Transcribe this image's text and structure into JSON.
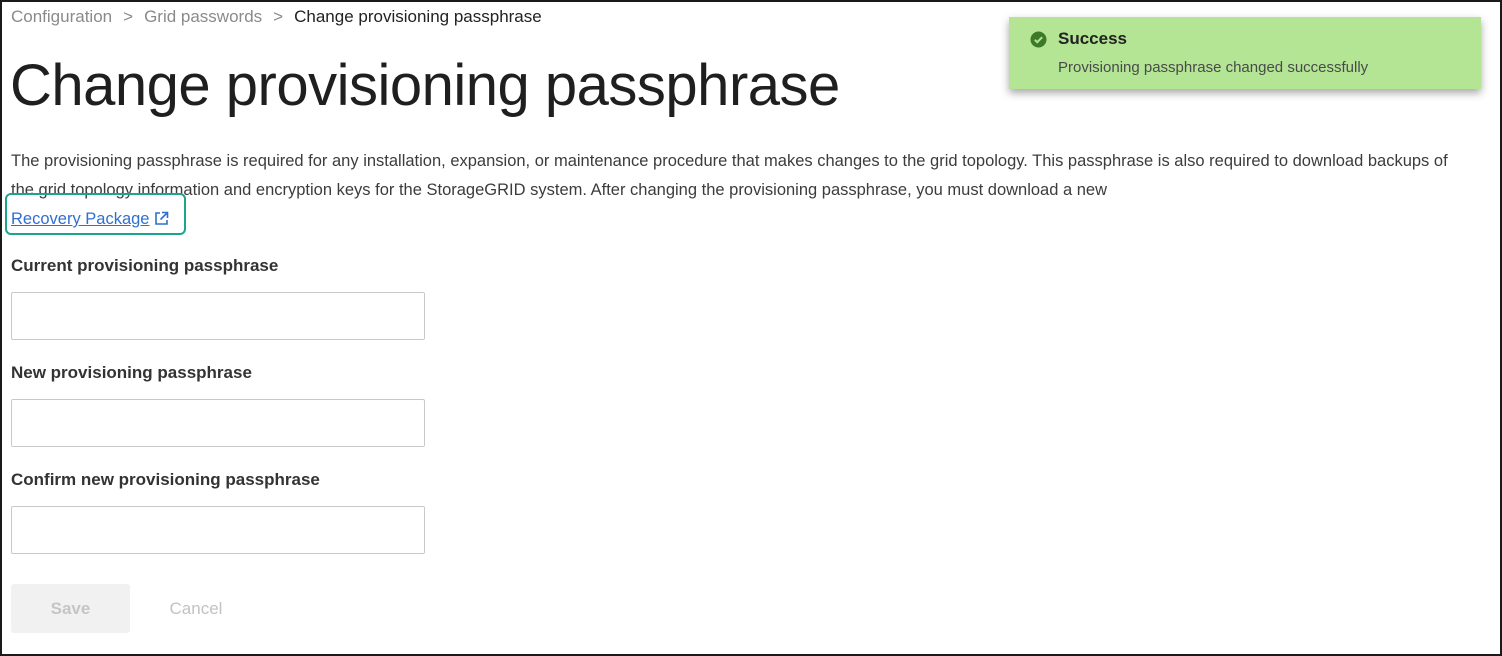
{
  "breadcrumb": {
    "items": [
      "Configuration",
      "Grid passwords"
    ],
    "separator": ">",
    "current": "Change provisioning passphrase"
  },
  "page_title": "Change provisioning passphrase",
  "description": {
    "text": "The provisioning passphrase is required for any installation, expansion, or maintenance procedure that makes changes to the grid topology. This passphrase is also required to download backups of the grid topology information and encryption keys for the StorageGRID system. After changing the provisioning passphrase, you must download a new ",
    "link_label": "Recovery Package",
    "link_icon": "external-link-icon"
  },
  "form": {
    "fields": [
      {
        "label": "Current provisioning passphrase",
        "value": "",
        "placeholder": ""
      },
      {
        "label": "New provisioning passphrase",
        "value": "",
        "placeholder": ""
      },
      {
        "label": "Confirm new provisioning passphrase",
        "value": "",
        "placeholder": ""
      }
    ],
    "save_label": "Save",
    "cancel_label": "Cancel"
  },
  "toast": {
    "icon": "check-circle-icon",
    "title": "Success",
    "message": "Provisioning passphrase changed successfully",
    "background_color": "#b3e595",
    "icon_color": "#3c7a2a"
  },
  "colors": {
    "link": "#2f6fd0",
    "highlight": "#1aa58c"
  }
}
